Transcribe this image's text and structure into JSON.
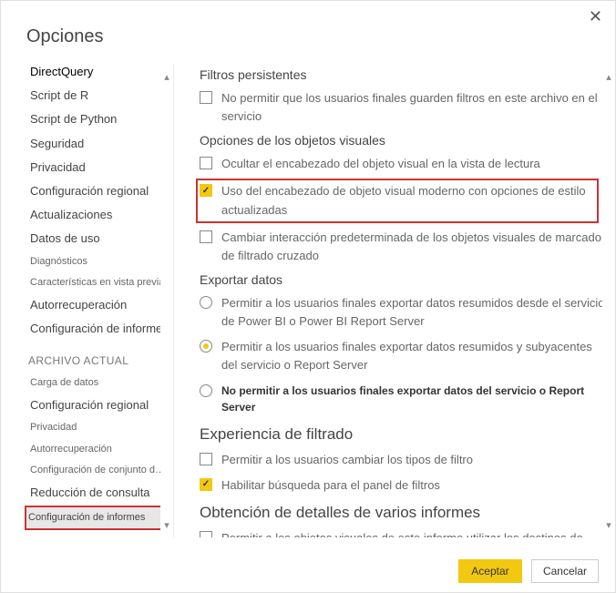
{
  "dialog_title": "Opciones",
  "nav": {
    "topItem": "DirectQuery",
    "items_global": [
      "Script de R",
      "Script de Python",
      "Seguridad",
      "Privacidad",
      "Configuración regional",
      "Actualizaciones",
      "Datos de uso",
      "Diagnósticos",
      "Características en vista previa",
      "Autorrecuperación",
      "Configuración de informes"
    ],
    "section_label": "ARCHIVO ACTUAL",
    "items_file": [
      "Carga de datos",
      "Configuración regional",
      "Privacidad",
      "Autorrecuperación",
      "Configuración de conjunto de datos publicada…",
      "Reducción de consulta"
    ],
    "selected": "Configuración de informes"
  },
  "content": {
    "g1_title": "Filtros persistentes",
    "g1_o1": "No permitir que los usuarios finales guarden filtros en este archivo en el servicio",
    "g2_title": "Opciones de los objetos visuales",
    "g2_o1": "Ocultar el encabezado del objeto visual en la vista de lectura",
    "g2_o2": "Uso del encabezado de objeto visual moderno con opciones de estilo actualizadas",
    "g2_o3": "Cambiar interacción predeterminada de los objetos visuales de marcado de filtrado cruzado",
    "g3_title": "Exportar datos",
    "g3_o1": "Permitir a los usuarios finales exportar datos resumidos desde el servicio de Power BI o Power BI Report Server",
    "g3_o2": "Permitir a los usuarios finales exportar datos resumidos y subyacentes del servicio o Report Server",
    "g3_o3": "No permitir a los usuarios finales exportar datos del servicio o Report Server",
    "g4_title": "Experiencia de filtrado",
    "g4_o1": "Permitir a los usuarios cambiar los tipos de filtro",
    "g4_o2": "Habilitar búsqueda para el panel de filtros",
    "g5_title": "Obtención de detalles de varios informes",
    "g5_o1": "Permitir a los objetos visuales de este informe utilizar los destinos de obtención de informes"
  },
  "buttons": {
    "ok": "Aceptar",
    "cancel": "Cancelar"
  }
}
